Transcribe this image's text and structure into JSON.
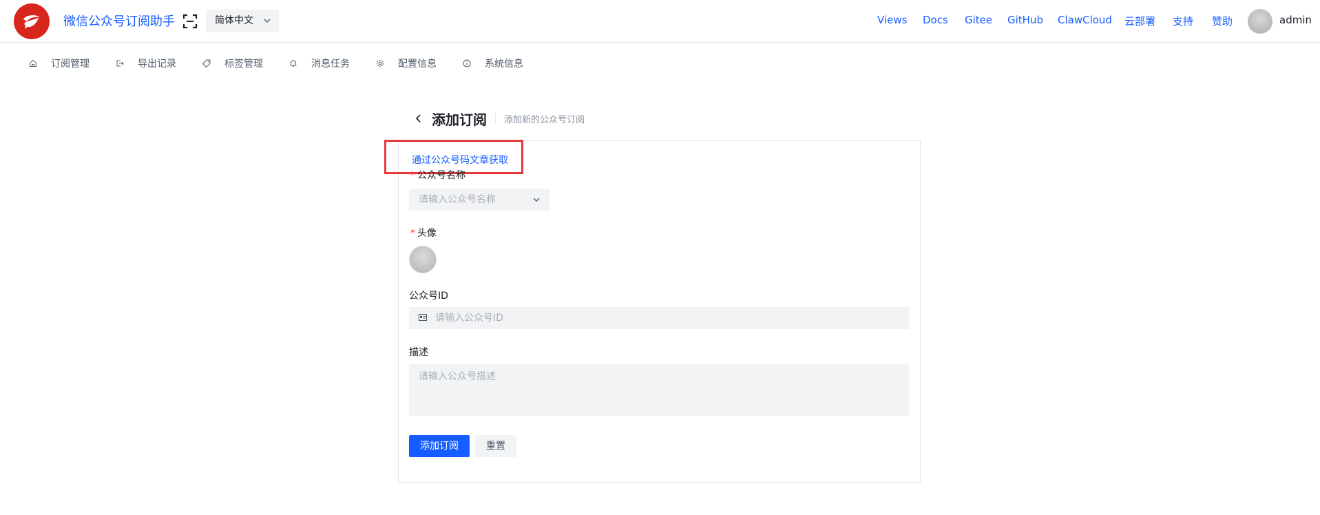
{
  "header": {
    "app_title": "微信公众号订阅助手",
    "language": "简体中文",
    "nav_links": [
      "Views",
      "Docs",
      "Gitee",
      "GitHub",
      "ClawCloud",
      "云部署",
      "支持",
      "赞助"
    ],
    "username": "admin"
  },
  "menu": {
    "items": [
      {
        "label": "订阅管理",
        "icon": "home-icon"
      },
      {
        "label": "导出记录",
        "icon": "export-icon"
      },
      {
        "label": "标签管理",
        "icon": "tag-icon"
      },
      {
        "label": "消息任务",
        "icon": "bell-icon"
      },
      {
        "label": "配置信息",
        "icon": "gear-icon"
      },
      {
        "label": "系统信息",
        "icon": "info-icon"
      }
    ]
  },
  "page": {
    "title": "添加订阅",
    "subtitle": "添加新的公众号订阅"
  },
  "form": {
    "fetch_link": "通过公众号码文章获取",
    "name_label": "公众号名称",
    "name_placeholder": "请输入公众号名称",
    "avatar_label": "头像",
    "id_label": "公众号ID",
    "id_placeholder": "请输入公众号ID",
    "desc_label": "描述",
    "desc_placeholder": "请输入公众号描述",
    "submit_label": "添加订阅",
    "reset_label": "重置"
  },
  "colors": {
    "accent": "#165dff",
    "logo": "#d9261c",
    "highlight": "#e5393d",
    "required": "#f53f3f"
  }
}
